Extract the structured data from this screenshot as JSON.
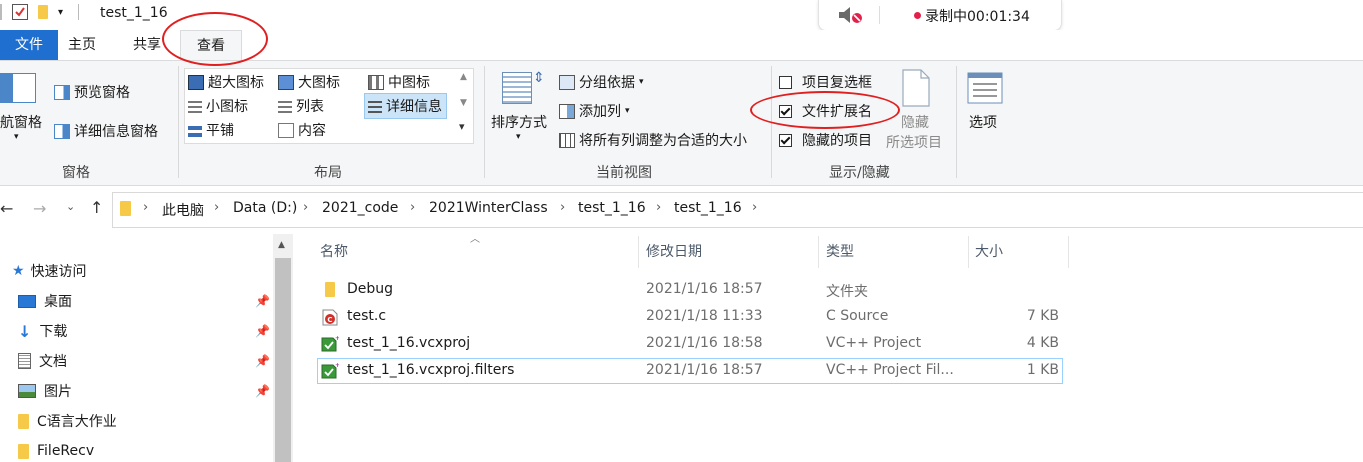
{
  "window": {
    "title": "test_1_16"
  },
  "recorder": {
    "status": "录制中00:01:34",
    "dot_color": "#e3204a",
    "icon": "speaker-muted-icon"
  },
  "tabs": [
    {
      "label": "文件"
    },
    {
      "label": "主页"
    },
    {
      "label": "共享"
    },
    {
      "label": "查看"
    }
  ],
  "ribbon": {
    "panes": {
      "nav_pane": "航窗格",
      "preview_pane": "预览窗格",
      "details_pane": "详细信息窗格",
      "group_label": "窗格"
    },
    "layout": {
      "items": [
        "超大图标",
        "大图标",
        "中图标",
        "小图标",
        "列表",
        "详细信息",
        "平铺",
        "内容"
      ],
      "group_label": "布局"
    },
    "current_view": {
      "sort": "排序方式",
      "group_by": "分组依据",
      "add_column": "添加列",
      "fit_columns": "将所有列调整为合适的大小",
      "group_label": "当前视图"
    },
    "show_hide": {
      "item_checkboxes": {
        "label": "项目复选框",
        "checked": false
      },
      "file_extensions": {
        "label": "文件扩展名",
        "checked": true
      },
      "hidden_items": {
        "label": "隐藏的项目",
        "checked": true
      },
      "hide_selected_1": "隐藏",
      "hide_selected_2": "所选项目",
      "group_label": "显示/隐藏"
    },
    "options": "选项"
  },
  "address": {
    "crumbs": [
      "此电脑",
      "Data (D:)",
      "2021_code",
      "2021WinterClass",
      "test_1_16",
      "test_1_16"
    ]
  },
  "nav": {
    "items": [
      "快速访问",
      "桌面",
      "下载",
      "文档",
      "图片",
      "C语言大作业",
      "FileRecv"
    ]
  },
  "list": {
    "columns": [
      "名称",
      "修改日期",
      "类型",
      "大小"
    ],
    "rows": [
      {
        "name": "Debug",
        "date": "2021/1/16 18:57",
        "type": "文件夹",
        "size": "",
        "icon": "folder-icon"
      },
      {
        "name": "test.c",
        "date": "2021/1/18 11:33",
        "type": "C Source",
        "size": "7 KB",
        "icon": "c-source-icon"
      },
      {
        "name": "test_1_16.vcxproj",
        "date": "2021/1/16 18:58",
        "type": "VC++ Project",
        "size": "4 KB",
        "icon": "vcxproj-icon"
      },
      {
        "name": "test_1_16.vcxproj.filters",
        "date": "2021/1/16 18:57",
        "type": "VC++ Project Fil...",
        "size": "1 KB",
        "icon": "vcxproj-icon"
      }
    ]
  },
  "colors": {
    "accent": "#1e6fcf",
    "annotation": "#e02020",
    "selection_border": "#99d1ff"
  }
}
